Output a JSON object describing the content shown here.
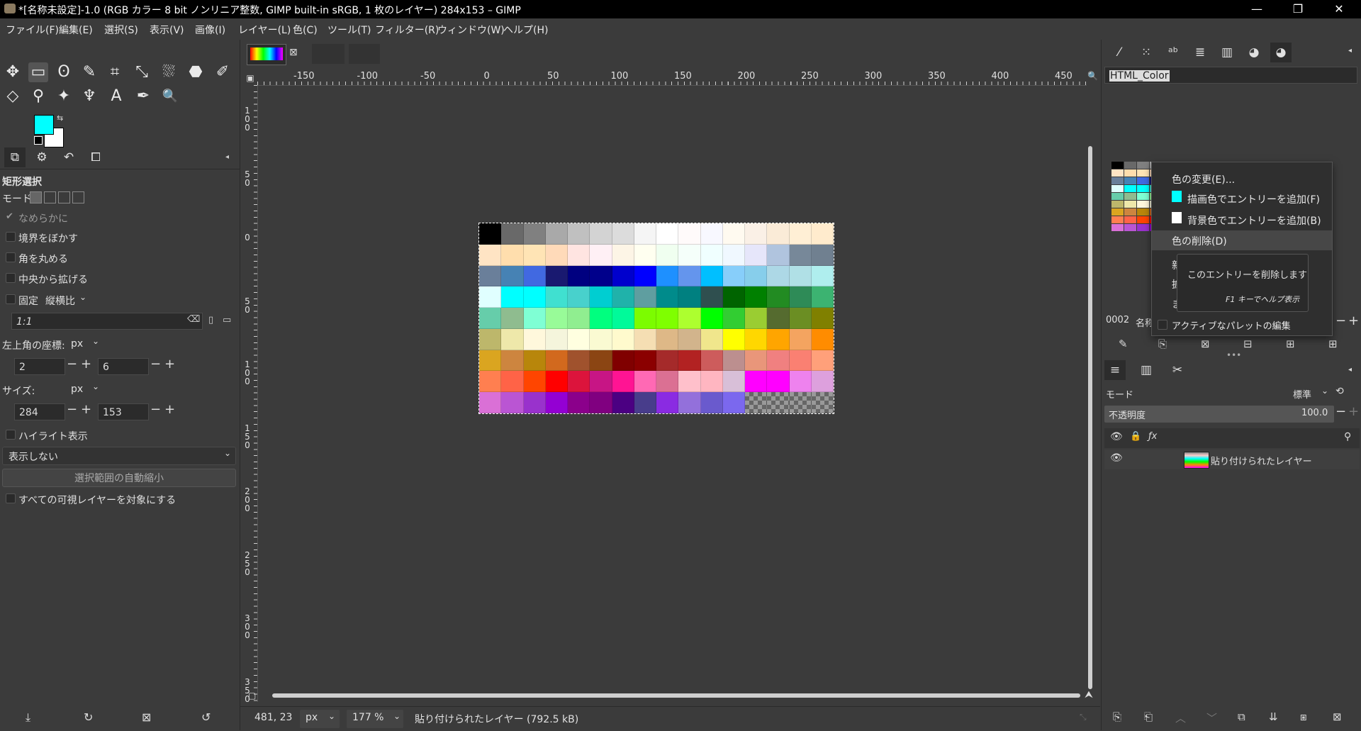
{
  "window": {
    "title": "*[名称未設定]-1.0 (RGB カラー 8 bit ノンリニア整数, GIMP built-in sRGB, 1 枚のレイヤー) 284x153 – GIMP",
    "minimize": "—",
    "maximize": "❐",
    "close": "✕"
  },
  "menu": [
    "ファイル(F)",
    "編集(E)",
    "選択(S)",
    "表示(V)",
    "画像(I)",
    "レイヤー(L)",
    "色(C)",
    "ツール(T)",
    "フィルター(R)",
    "ウィンドウ(W)",
    "ヘルプ(H)"
  ],
  "toolbox": {
    "row1": [
      "✥",
      "▭",
      "ʘ",
      "✎",
      "⌗",
      "⤡",
      "⛆",
      "⬣",
      "✐"
    ],
    "row2": [
      "◇",
      "⚲",
      "✦",
      "♆",
      "A",
      "✒",
      "🔍"
    ]
  },
  "colors": {
    "foreground": "#00ffff",
    "background": "#ffffff"
  },
  "tool_options": {
    "title": "矩形選択",
    "mode_label": "モード:",
    "antialias": "なめらかに",
    "feather": "境界をぼかす",
    "round_corners": "角を丸める",
    "expand_center": "中央から拡げる",
    "fixed": "固定",
    "fixed_mode": "縦横比",
    "ratio_value": "1:1",
    "position_label": "左上角の座標:",
    "position_unit": "px",
    "pos_x": "2",
    "pos_y": "6",
    "size_label": "サイズ:",
    "size_unit": "px",
    "size_w": "284",
    "size_h": "153",
    "highlight": "ハイライト表示",
    "guides": "表示しない",
    "auto_shrink": "選択範囲の自動縮小",
    "merged": "すべての可視レイヤーを対象にする"
  },
  "ruler": {
    "h_labels": [
      "-150",
      "-100",
      "-50",
      "0",
      "50",
      "100",
      "150",
      "200",
      "250",
      "300",
      "350",
      "400",
      "450"
    ],
    "v_labels": [
      "1\n0\n0",
      "5\n0",
      "0",
      "5\n0",
      "1\n0\n0",
      "1\n5\n0",
      "2\n0\n0",
      "2\n5\n0",
      "3\n0\n0",
      "3\n5\n0"
    ]
  },
  "status": {
    "coords": "481, 23",
    "unit": "px",
    "zoom": "177 %",
    "message": "貼り付けられたレイヤー (792.5 kB)"
  },
  "palette": {
    "name_field": "HTML_Color",
    "entry_index": "0002",
    "name_label": "名称"
  },
  "context_menu": {
    "items": [
      "色の変更(E)...",
      "描画色でエントリーを追加(F)",
      "背景色でエントリーを追加(B)",
      "色の削除(D)"
    ],
    "hidden_item_prefix": [
      "新",
      "拡",
      "ま"
    ],
    "active_palette_edit": "アクティブなパレットの編集",
    "tooltip_text": "このエントリーを削除します",
    "tooltip_help": "F1 キーでヘルプ表示"
  },
  "layers": {
    "mode_label": "モード",
    "mode_value": "標準",
    "opacity_label": "不透明度",
    "opacity_value": "100.0",
    "layer_name": "貼り付けられたレイヤー"
  },
  "image_colors": [
    "#000000",
    "#696969",
    "#808080",
    "#a9a9a9",
    "#c0c0c0",
    "#d3d3d3",
    "#dcdcdc",
    "#f5f5f5",
    "#ffffff",
    "#fffafa",
    "#f8f8ff",
    "#fffaf0",
    "#faf0e6",
    "#faebd7",
    "#ffefd5",
    "#ffebcd",
    "#ffe4c4",
    "#ffdead",
    "#ffe4b5",
    "#ffdab9",
    "#ffe4e1",
    "#fff0f5",
    "#fdf5e6",
    "#fffff0",
    "#f0fff0",
    "#f5fffa",
    "#f0ffff",
    "#f0f8ff",
    "#e6e6fa",
    "#b0c4de",
    "#778899",
    "#708090",
    "#6a7f9a",
    "#4682b4",
    "#4169e1",
    "#191970",
    "#000080",
    "#00008b",
    "#0000cd",
    "#0000ff",
    "#1e90ff",
    "#6495ed",
    "#00bfff",
    "#87cefa",
    "#87ceeb",
    "#add8e6",
    "#b0e0e6",
    "#afeeee",
    "#e0ffff",
    "#00ffff",
    "#00ffff",
    "#40e0d0",
    "#48d1cc",
    "#00ced1",
    "#20b2aa",
    "#5f9ea0",
    "#008b8b",
    "#008080",
    "#2f4f4f",
    "#006400",
    "#008000",
    "#228b22",
    "#2e8b57",
    "#3cb371",
    "#66cdaa",
    "#8fbc8f",
    "#7fffd4",
    "#98fb98",
    "#90ee90",
    "#00ff7f",
    "#00fa9a",
    "#7cfc00",
    "#7fff00",
    "#adff2f",
    "#00ff00",
    "#32cd32",
    "#9acd32",
    "#556b2f",
    "#6b8e23",
    "#808000",
    "#bdb76b",
    "#eee8aa",
    "#fff8dc",
    "#f5f5dc",
    "#ffffe0",
    "#fafad2",
    "#fffacd",
    "#f5deb3",
    "#deb887",
    "#d2b48c",
    "#f0e68c",
    "#ffff00",
    "#ffd700",
    "#ffa500",
    "#f4a460",
    "#ff8c00",
    "#daa520",
    "#cd853f",
    "#b8860b",
    "#d2691e",
    "#a0522d",
    "#8b4513",
    "#800000",
    "#8b0000",
    "#a52a2a",
    "#b22222",
    "#cd5c5c",
    "#bc8f8f",
    "#e9967a",
    "#f08080",
    "#fa8072",
    "#ffa07a",
    "#ff7f50",
    "#ff6347",
    "#ff4500",
    "#ff0000",
    "#dc143c",
    "#c71585",
    "#ff1493",
    "#ff69b4",
    "#db7093",
    "#ffc0cb",
    "#ffb6c1",
    "#d8bfd8",
    "#ff00ff",
    "#ff00ff",
    "#ee82ee",
    "#dda0dd",
    "#da70d6",
    "#ba55d3",
    "#9932cc",
    "#9400d3",
    "#8b008b",
    "#800080",
    "#4b0082",
    "#483d8b",
    "#8a2be2",
    "#9370db",
    "#6a5acd",
    "#7b68ee",
    "transparent",
    "transparent",
    "transparent",
    "transparent"
  ]
}
